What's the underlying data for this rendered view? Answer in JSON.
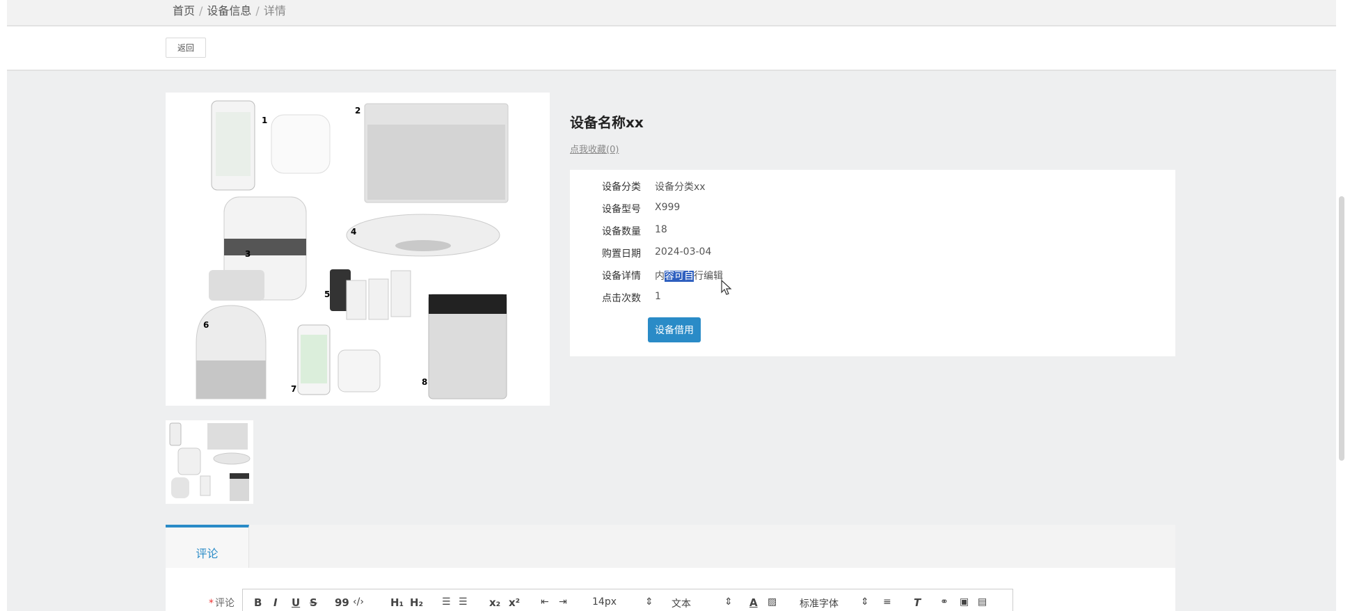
{
  "breadcrumb": {
    "home": "首页",
    "section": "设备信息",
    "current": "详情",
    "sep": "/"
  },
  "actions": {
    "back": "返回"
  },
  "device": {
    "title": "设备名称xx",
    "collect": "点我收藏(0)",
    "fields": [
      {
        "label": "设备分类",
        "value": "设备分类xx"
      },
      {
        "label": "设备型号",
        "value": "X999"
      },
      {
        "label": "设备数量",
        "value": "18"
      },
      {
        "label": "购置日期",
        "value": "2024-03-04"
      },
      {
        "label": "设备详情",
        "value_pre": "内",
        "value_sel": "容可自",
        "value_post": "行编辑"
      },
      {
        "label": "点击次数",
        "value": "1"
      }
    ],
    "borrow_button": "设备借用"
  },
  "tabs": {
    "comments": "评论"
  },
  "editor": {
    "label": "评论",
    "required_mark": "*",
    "toolbar": {
      "bold": "B",
      "italic": "I",
      "underline": "U",
      "strike": "S",
      "quote": "99",
      "code": "‹/›",
      "h1": "H₁",
      "h2": "H₂",
      "sub": "x₂",
      "sup": "x²",
      "size": "14px",
      "heading": "文本",
      "font": "标准字体"
    }
  }
}
